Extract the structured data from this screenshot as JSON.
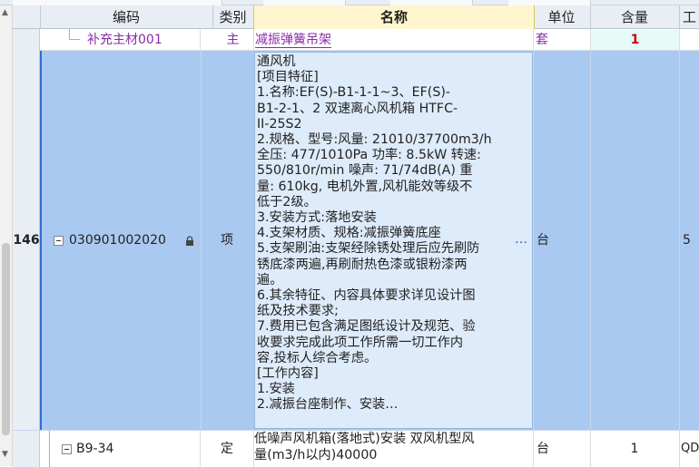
{
  "columns": {
    "code": "编码",
    "category": "类别",
    "name": "名称",
    "unit": "单位",
    "quantity": "含量",
    "last": "工"
  },
  "rows": [
    {
      "code": "补充主材001",
      "category": "主",
      "name": "减振弹簧吊架",
      "unit": "套",
      "quantity": "1"
    },
    {
      "row_no": "146",
      "code": "030901002020",
      "category": "项",
      "name_lines": [
        "通风机",
        "[项目特征]",
        "1.名称:EF(S)-B1-1-1~3、EF(S)-",
        "B1-2-1、2 双速离心风机箱 HTFC-",
        "II-25S2",
        "2.规格、型号:风量: 21010/37700m3/h",
        "全压: 477/1010Pa 功率: 8.5kW 转速:",
        "550/810r/min 噪声: 71/74dB(A) 重",
        "量: 610kg, 电机外置,风机能效等级不",
        "低于2级。",
        "3.安装方式:落地安装",
        "4.支架材质、规格:减振弹簧底座",
        "5.支架刷油:支架经除锈处理后应先刷防",
        "锈底漆两遍,再刷耐热色漆或银粉漆两",
        "遍。",
        "6.其余特征、内容具体要求详见设计图",
        "纸及技术要求;",
        "7.费用已包含满足图纸设计及规范、验",
        "收要求完成此项工作所需一切工作内",
        "容,投标人综合考虑。",
        "[工作内容]",
        "1.安装",
        "2.减振台座制作、安装…"
      ],
      "more": "…",
      "unit": "台",
      "quantity": "5"
    },
    {
      "code": "B9-34",
      "category": "定",
      "name_lines": [
        "低噪声风机箱(落地式)安装 双风机型风",
        "量(m3/h以内)40000"
      ],
      "unit": "台",
      "quantity": "1",
      "last": "QDI"
    }
  ],
  "icons": [
    "lock-icon",
    "collapse-icon"
  ],
  "colors": {
    "selected_row": "#aac9f1",
    "selected_cell": "#ddebfa",
    "header_active": "#fff6cf",
    "purple_text": "#8c2aa8",
    "red_text": "#cc0000"
  }
}
